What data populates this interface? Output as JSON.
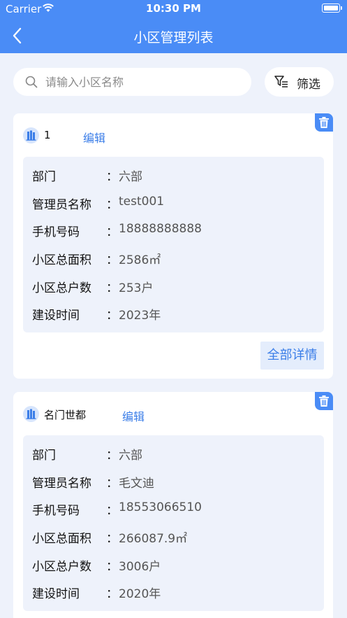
{
  "status_bar": {
    "carrier": "Carrier",
    "time": "10:30 PM"
  },
  "nav": {
    "title": "小区管理列表"
  },
  "search": {
    "placeholder": "请输入小区名称",
    "value": ""
  },
  "filter": {
    "label": "筛选"
  },
  "colors": {
    "primary": "#4a8cf6",
    "link": "#3b7ee8",
    "page_bg": "#eef2fb"
  },
  "communities": [
    {
      "name": "1",
      "edit_label": "编辑",
      "fields": [
        {
          "label": "部门",
          "colon": "：",
          "value": "六部"
        },
        {
          "label": "管理员名称",
          "colon": "：",
          "value": "test001"
        },
        {
          "label": "手机号码",
          "colon": "：",
          "value": "18888888888"
        },
        {
          "label": "小区总面积",
          "colon": "：",
          "value": "2586㎡"
        },
        {
          "label": "小区总户数",
          "colon": "：",
          "value": "253户"
        },
        {
          "label": "建设时间",
          "colon": "：",
          "value": "2023年"
        }
      ],
      "detail_label": "全部详情"
    },
    {
      "name": "名门世都",
      "edit_label": "编辑",
      "fields": [
        {
          "label": "部门",
          "colon": "：",
          "value": "六部"
        },
        {
          "label": "管理员名称",
          "colon": "：",
          "value": "毛文迪"
        },
        {
          "label": "手机号码",
          "colon": "：",
          "value": "18553066510"
        },
        {
          "label": "小区总面积",
          "colon": "：",
          "value": "266087.9㎡"
        },
        {
          "label": "小区总户数",
          "colon": "：",
          "value": "3006户"
        },
        {
          "label": "建设时间",
          "colon": "：",
          "value": "2020年"
        }
      ]
    }
  ]
}
